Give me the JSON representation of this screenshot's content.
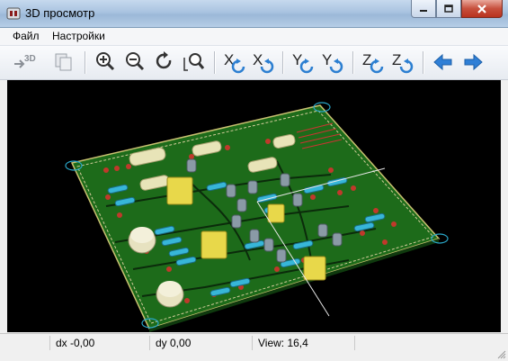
{
  "window": {
    "title": "3D просмотр"
  },
  "menu": {
    "items": [
      "Файл",
      "Настройки"
    ]
  },
  "toolbar": {
    "buttons": [
      {
        "name": "3d-export-button",
        "label": "3D"
      },
      {
        "name": "copy-button",
        "label": ""
      },
      {
        "name": "zoom-in-button",
        "label": ""
      },
      {
        "name": "zoom-out-button",
        "label": ""
      },
      {
        "name": "redraw-button",
        "label": ""
      },
      {
        "name": "zoom-fit-button",
        "label": ""
      },
      {
        "name": "rotate-x-ccw-button",
        "label": "X"
      },
      {
        "name": "rotate-x-cw-button",
        "label": "X"
      },
      {
        "name": "rotate-y-ccw-button",
        "label": "Y"
      },
      {
        "name": "rotate-y-cw-button",
        "label": "Y"
      },
      {
        "name": "rotate-z-ccw-button",
        "label": "Z"
      },
      {
        "name": "rotate-z-cw-button",
        "label": "Z"
      },
      {
        "name": "pan-left-button",
        "label": ""
      },
      {
        "name": "pan-right-button",
        "label": ""
      }
    ]
  },
  "status": {
    "dx": "dx -0,00",
    "dy": "dy 0,00",
    "view": "View: 16,4"
  },
  "colors": {
    "board": "#1d6b1a",
    "viewport_bg": "#000000",
    "title_gradient": "#a9c3e0"
  }
}
